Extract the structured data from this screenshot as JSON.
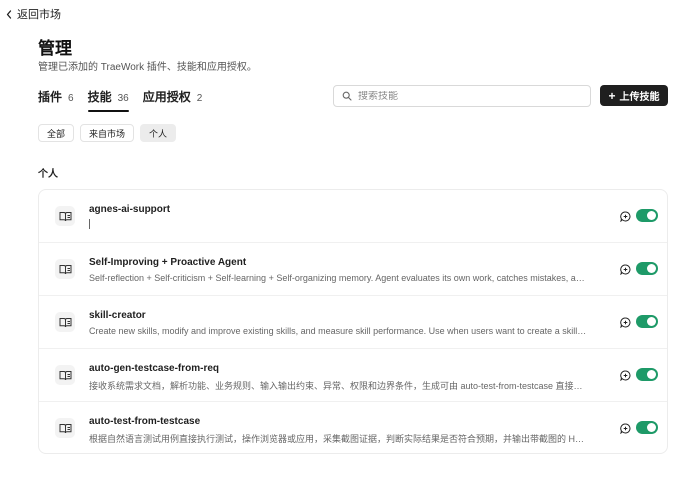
{
  "header": {
    "back_label": "返回市场",
    "title": "管理",
    "subtitle": "管理已添加的 TraeWork 插件、技能和应用授权。"
  },
  "tabs": [
    {
      "label": "插件",
      "count": "6",
      "active": false
    },
    {
      "label": "技能",
      "count": "36",
      "active": true
    },
    {
      "label": "应用授权",
      "count": "2",
      "active": false
    }
  ],
  "search": {
    "placeholder": "搜索技能",
    "value": ""
  },
  "upload_button": {
    "label": "上传技能"
  },
  "filters": [
    {
      "label": "全部",
      "active": false
    },
    {
      "label": "来自市场",
      "active": false
    },
    {
      "label": "个人",
      "active": true
    }
  ],
  "section_title": "个人",
  "skills": [
    {
      "name": "agnes-ai-support",
      "description": "",
      "enabled": true
    },
    {
      "name": "Self-Improving + Proactive Agent",
      "description": "Self-reflection + Self-criticism + Self-learning + Self-organizing memory. Agent evaluates its own work, catches mistakes, and impr...",
      "enabled": true
    },
    {
      "name": "skill-creator",
      "description": "Create new skills, modify and improve existing skills, and measure skill performance. Use when users want to create a skill from scr...",
      "enabled": true
    },
    {
      "name": "auto-gen-testcase-from-req",
      "description": "接收系统需求文档，解析功能、业务规则、输入输出约束、异常、权限和边界条件，生成可由 auto-test-from-testcase 直接执行的...",
      "enabled": true
    },
    {
      "name": "auto-test-from-testcase",
      "description": "根据自然语言测试用例直接执行测试，操作浏览器或应用，采集截图证据，判断实际结果是否符合预期，并输出带截图的 HTML 测...",
      "enabled": true
    }
  ],
  "colors": {
    "toggle_on": "#1e9a68",
    "primary_button": "#1f1f1f"
  }
}
